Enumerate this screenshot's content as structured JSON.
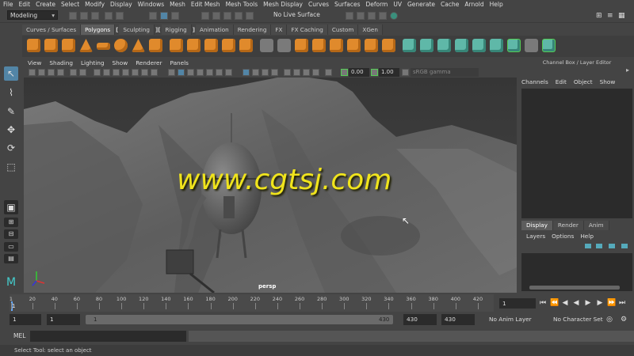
{
  "menubar": [
    "File",
    "Edit",
    "Create",
    "Select",
    "Modify",
    "Display",
    "Windows",
    "Mesh",
    "Edit Mesh",
    "Mesh Tools",
    "Mesh Display",
    "Curves",
    "Surfaces",
    "Deform",
    "UV",
    "Generate",
    "Cache",
    "Arnold",
    "Help"
  ],
  "statusline": {
    "mode": "Modeling",
    "live_surface": "No Live Surface"
  },
  "shelf_tabs": [
    "Curves / Surfaces",
    "Polygons",
    "Sculpting",
    "Rigging",
    "Animation",
    "Rendering",
    "FX",
    "FX Caching",
    "Custom",
    "XGen"
  ],
  "shelf_active": "Polygons",
  "viewport": {
    "menu": [
      "View",
      "Shading",
      "Lighting",
      "Show",
      "Renderer",
      "Panels"
    ],
    "exposure": "0.00",
    "gamma": "1.00",
    "colorspace": "sRGB gamma",
    "camera_label": "persp"
  },
  "watermark": "www.cgtsj.com",
  "channel_box": {
    "title": "Channel Box / Layer Editor",
    "menu": [
      "Channels",
      "Edit",
      "Object",
      "Show"
    ],
    "layer_tabs": [
      "Display",
      "Render",
      "Anim"
    ],
    "layer_menu": [
      "Layers",
      "Options",
      "Help"
    ]
  },
  "timeslider": {
    "ticks": [
      "1",
      "20",
      "40",
      "60",
      "80",
      "100",
      "120",
      "140",
      "160",
      "180",
      "200",
      "220",
      "240",
      "260",
      "280",
      "300",
      "320",
      "340",
      "360",
      "380",
      "400",
      "420"
    ],
    "current_frame": "1"
  },
  "rangebar": {
    "start": "1",
    "playback_start": "1",
    "slider_start": "1",
    "slider_end": "430",
    "playback_end": "430",
    "end": "430",
    "anim_layer": "No Anim Layer",
    "character_set": "No Character Set"
  },
  "cmdline": {
    "label": "MEL"
  },
  "helpline": "Select Tool: select an object",
  "colors": {
    "accent_select": "#5285a6",
    "shelf_orange": "#e08a2c",
    "shelf_teal": "#5fb8a8",
    "watermark": "#f0e41c"
  }
}
